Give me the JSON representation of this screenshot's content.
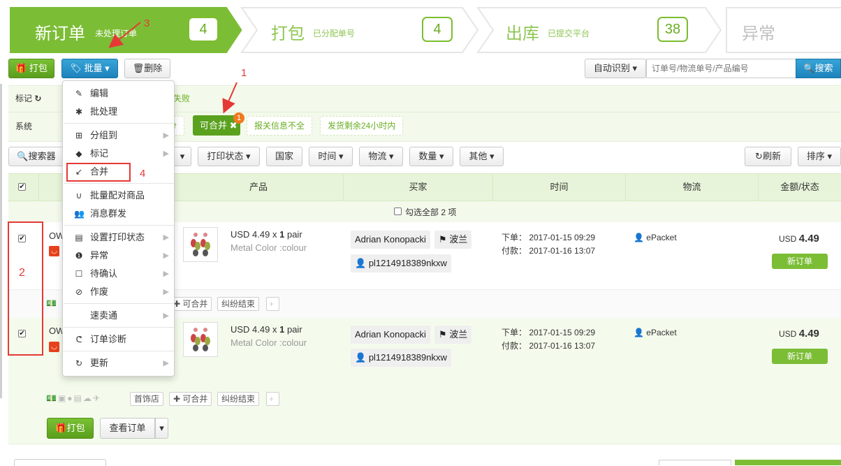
{
  "colors": {
    "accent_green": "#7cbd36",
    "dark_green": "#5a9e1c",
    "blue": "#1e83bd",
    "annotation_red": "#e53935"
  },
  "steps": [
    {
      "title": "新订单",
      "sub": "未处理订单",
      "count": "4"
    },
    {
      "title": "打包",
      "sub": "已分配单号",
      "count": "4"
    },
    {
      "title": "出库",
      "sub": "已提交平台",
      "count": "38"
    },
    {
      "title": "异常"
    }
  ],
  "toolbar": {
    "pack": "打包",
    "batch": "批量",
    "delete": "删除"
  },
  "search": {
    "mode": "自动识别",
    "placeholder": "订单号/物流单号/产品编号",
    "button": "搜索"
  },
  "filters": {
    "mark_label": "标记",
    "system_label": "系统",
    "fail_chip": "包失败",
    "merge_chip": "可合并",
    "merge_badge": "1",
    "info_chip": "报关信息不全",
    "remain_chip": "发货剩余24小时内",
    "fen_chip": "分"
  },
  "filterbar": {
    "searcher": "搜索器",
    "print_status": "打印状态",
    "country": "国家",
    "time": "时间",
    "logistics": "物流",
    "quantity": "数量",
    "other": "其他",
    "refresh": "刷新",
    "sort": "排序"
  },
  "table": {
    "headers": {
      "product": "产品",
      "buyer": "买家",
      "time": "时间",
      "logistics": "物流",
      "amount": "金额/状态"
    },
    "select_all": "勾选全部 2 项"
  },
  "orders": [
    {
      "id_prefix": "OW",
      "price_line": "USD 4.49 x",
      "qty": "1",
      "unit": "pair",
      "variant": "Metal Color :colour",
      "buyer": "Adrian Konopacki",
      "country": "波兰",
      "buyer_id": "pl1214918389nkxw",
      "order_time": "下单： 2017-01-15 09:29",
      "pay_time": "付款： 2017-01-16 13:07",
      "carrier": "ePacket",
      "currency": "USD",
      "amount": "4.49",
      "status": "新订单",
      "shop": "",
      "merge_tag": "可合并",
      "dispute_tag": "纠纷结束"
    },
    {
      "id_prefix": "OW",
      "price_line": "USD 4.49 x",
      "qty": "1",
      "unit": "pair",
      "variant": "Metal Color :colour",
      "buyer": "Adrian Konopacki",
      "country": "波兰",
      "buyer_id": "pl1214918389nkxw",
      "order_time": "下单： 2017-01-15 09:29",
      "pay_time": "付款： 2017-01-16 13:07",
      "carrier": "ePacket",
      "currency": "USD",
      "amount": "4.49",
      "status": "新订单",
      "shop": "首饰店",
      "merge_tag": "可合并",
      "dispute_tag": "纠纷结束"
    }
  ],
  "footer": {
    "pack": "打包",
    "view": "查看订单"
  },
  "menu": {
    "items": [
      {
        "icon": "edit-icon",
        "label": "编辑"
      },
      {
        "icon": "magic-icon",
        "label": "批处理"
      },
      {
        "icon": "sitemap-icon",
        "label": "分组到"
      },
      {
        "icon": "tag-icon",
        "label": "标记"
      },
      {
        "icon": "merge-icon",
        "label": "合并"
      },
      {
        "icon": "magnet-icon",
        "label": "批量配对商品"
      },
      {
        "icon": "users-icon",
        "label": "消息群发"
      },
      {
        "icon": "print-icon",
        "label": "设置打印状态"
      },
      {
        "icon": "alert-icon",
        "label": "异常"
      },
      {
        "icon": "square-icon",
        "label": "待确认"
      },
      {
        "icon": "ban-icon",
        "label": "作废"
      },
      {
        "icon": "blank-icon",
        "label": "速卖通"
      },
      {
        "icon": "stethoscope-icon",
        "label": "订单诊断"
      },
      {
        "icon": "refresh-icon",
        "label": "更新"
      }
    ]
  },
  "annotations": {
    "n1": "1",
    "n2": "2",
    "n3": "3",
    "n4": "4"
  }
}
